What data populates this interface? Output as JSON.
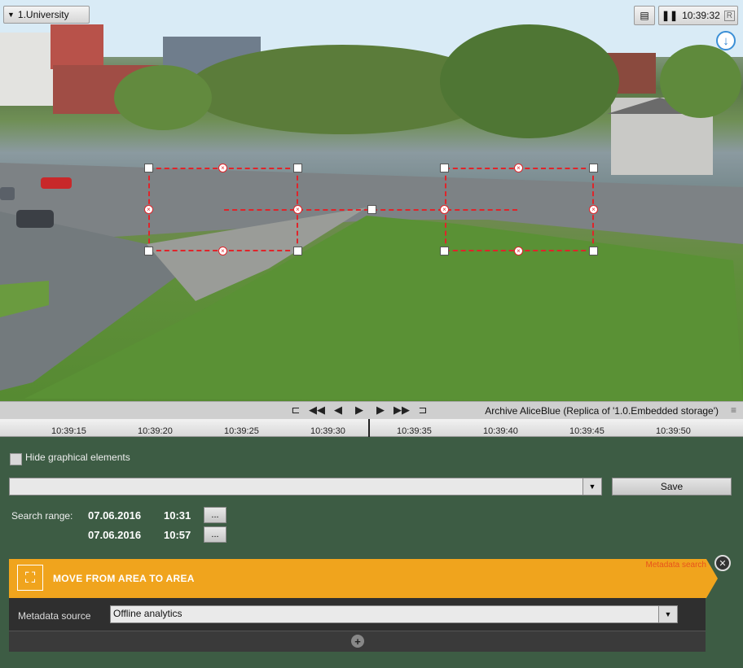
{
  "camera": {
    "name": "1.University"
  },
  "clock": {
    "time": "10:39:32",
    "mode": "R"
  },
  "icons": {
    "menu": "menu-icon",
    "download": "download-icon",
    "pause": "pause-icon",
    "notes": "notes-icon"
  },
  "player": {
    "controls": [
      "⊏",
      "◀◀",
      "◀",
      "▶",
      "▶",
      "▶▶",
      "⊐"
    ],
    "archive_label": "Archive AliceBlue (Replica of '1.0.Embedded storage')"
  },
  "timeline": {
    "ticks": [
      "10:39:15",
      "10:39:20",
      "10:39:25",
      "10:39:30",
      "10:39:35",
      "10:39:40",
      "10:39:45",
      "10:39:50"
    ]
  },
  "panel": {
    "hide_graphics_label": "Hide graphical elements",
    "save_label": "Save",
    "search_range_label": "Search range:",
    "range_from_date": "07.06.2016",
    "range_from_time": "10:31",
    "range_to_date": "07.06.2016",
    "range_to_time": "10:57",
    "dots": "...",
    "banner_title": "MOVE FROM AREA TO AREA",
    "metadata_search": "Metadata search",
    "metadata_source_label": "Metadata source",
    "metadata_source_value": "Offline analytics"
  },
  "colors": {
    "banner": "#f0a41d",
    "zone_line": "#e0242a",
    "panel_bg": "#3d5c44"
  }
}
